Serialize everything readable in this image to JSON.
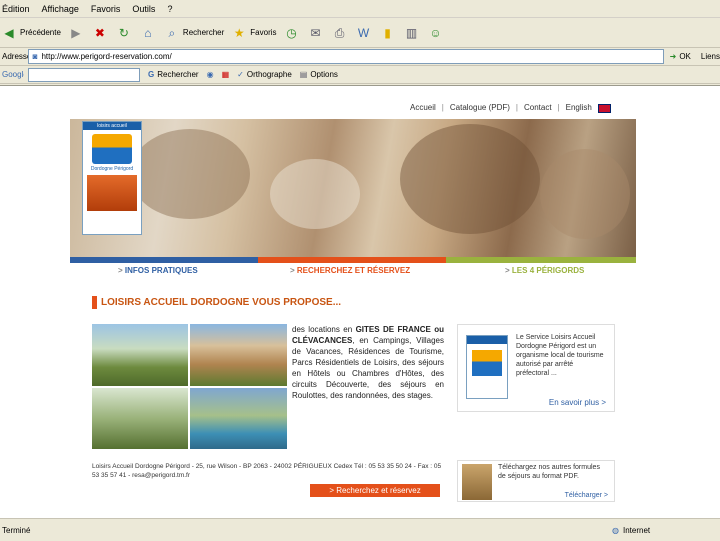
{
  "menu": [
    "Édition",
    "Affichage",
    "Favoris",
    "Outils",
    "?"
  ],
  "toolbar": {
    "back": "Précédente",
    "search": "Rechercher",
    "favorites": "Favoris"
  },
  "address": {
    "label": "Adresse",
    "url": "http://www.perigord-reservation.com/",
    "go": "OK",
    "links": "Liens"
  },
  "google": {
    "label": "Google",
    "search": "Rechercher",
    "spell": "Orthographe",
    "options": "Options"
  },
  "page": {
    "topnav": [
      "Accueil",
      "Catalogue (PDF)",
      "Contact",
      "English"
    ],
    "logo_top": "loisirs accueil",
    "logo_bottom": "Dordogne Périgord",
    "tabs": [
      "INFOS PRATIQUES",
      "RECHERCHEZ ET RÉSERVEZ",
      "LES 4 PÉRIGORDS"
    ],
    "heading": "LOISIRS ACCUEIL DORDOGNE VOUS PROPOSE...",
    "desc_1": "des locations en ",
    "desc_bold": "GITES DE FRANCE ou CLÉVACANCES",
    "desc_2": ", en Campings, Villages de Vacances, Résidences de Tourisme, Parcs Résidentiels de Loisirs, des séjours en Hôtels ou Chambres d'Hôtes, des circuits Découverte, des séjours en Roulottes, des randonnées, des stages.",
    "side1_text": "Le Service Loisirs Accueil Dordogne Périgord est un organisme local de tourisme autorisé par arrêté préfectoral ...",
    "side1_more": "En savoir plus >",
    "footline": "Loisirs Accueil Dordogne Périgord - 25, rue Wilson - BP 2063 - 24002 PÉRIGUEUX Cedex Tél : 05 53 35 50 24 - Fax : 05 53 35 57 41 - resa@perigord.tm.fr",
    "cta": "> Recherchez et réservez",
    "side2_text": "Téléchargez nos autres formules de séjours au format PDF.",
    "side2_dl": "Télécharger >"
  },
  "status": {
    "left": "Terminé",
    "zone": "Internet"
  }
}
